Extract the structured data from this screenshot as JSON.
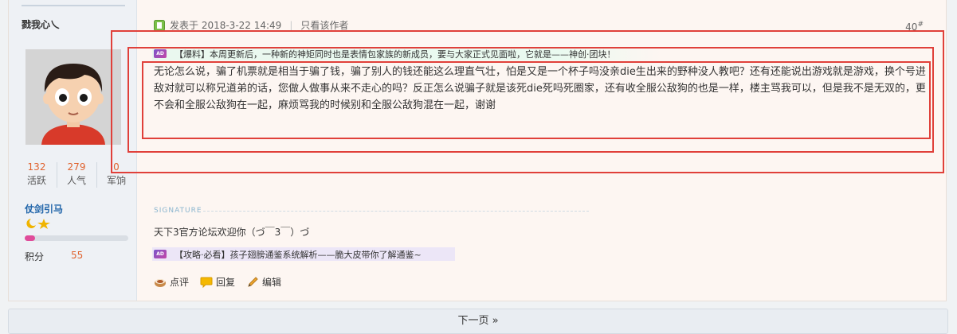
{
  "user": {
    "name": "戮我心乀",
    "stats": [
      {
        "value": "132",
        "label": "活跃"
      },
      {
        "value": "279",
        "label": "人气"
      },
      {
        "value": "0",
        "label": "军饷"
      }
    ],
    "group": "仗剑引马",
    "level_progress": 0.1,
    "points_label": "积分",
    "points_value": "55"
  },
  "post": {
    "posted_at": "发表于 2018-3-22 14:49",
    "only_author": "只看该作者",
    "floor": "40",
    "floor_suffix": "#",
    "ad_top_badge": "AD",
    "ad_top": "【爆料】本周更新后，一种新的神矩同时也是表情包家族的新成员，要与大家正式见面啦，它就是——神创·团块！",
    "message": "无论怎么说，骗了机票就是相当于骗了钱，骗了别人的钱还能这么理直气壮，怕是又是一个杯子吗没亲die生出来的野种没人教吧？还有还能说出游戏就是游戏，换个号进敌对就可以称兄道弟的话，您做人做事从来不走心的吗？反正怎么说骗子就是该死die死吗死圈家，还有收全服公敌狗的也是一样，楼主骂我可以，但是我不是无双的，更不会和全服公敌狗在一起，麻烦骂我的时候别和全服公敌狗混在一起，谢谢",
    "signature_label": "SIGNATURE",
    "signature": "天下3官方论坛欢迎你（づ￣3￣）づ",
    "ad_bottom_badge": "AD",
    "ad_bottom": "【攻略·必看】孩子翅膀通鉴系统解析——脆大皮带你了解通鉴~"
  },
  "actions": {
    "rate": "点评",
    "reply": "回复",
    "edit": "编辑"
  },
  "pager": {
    "next": "下一页 »"
  },
  "colors": {
    "highlight_box": "#e0403a",
    "stat_number": "#e0632f",
    "group_name": "#2266aa",
    "progress_fill": "#e04c9a"
  }
}
